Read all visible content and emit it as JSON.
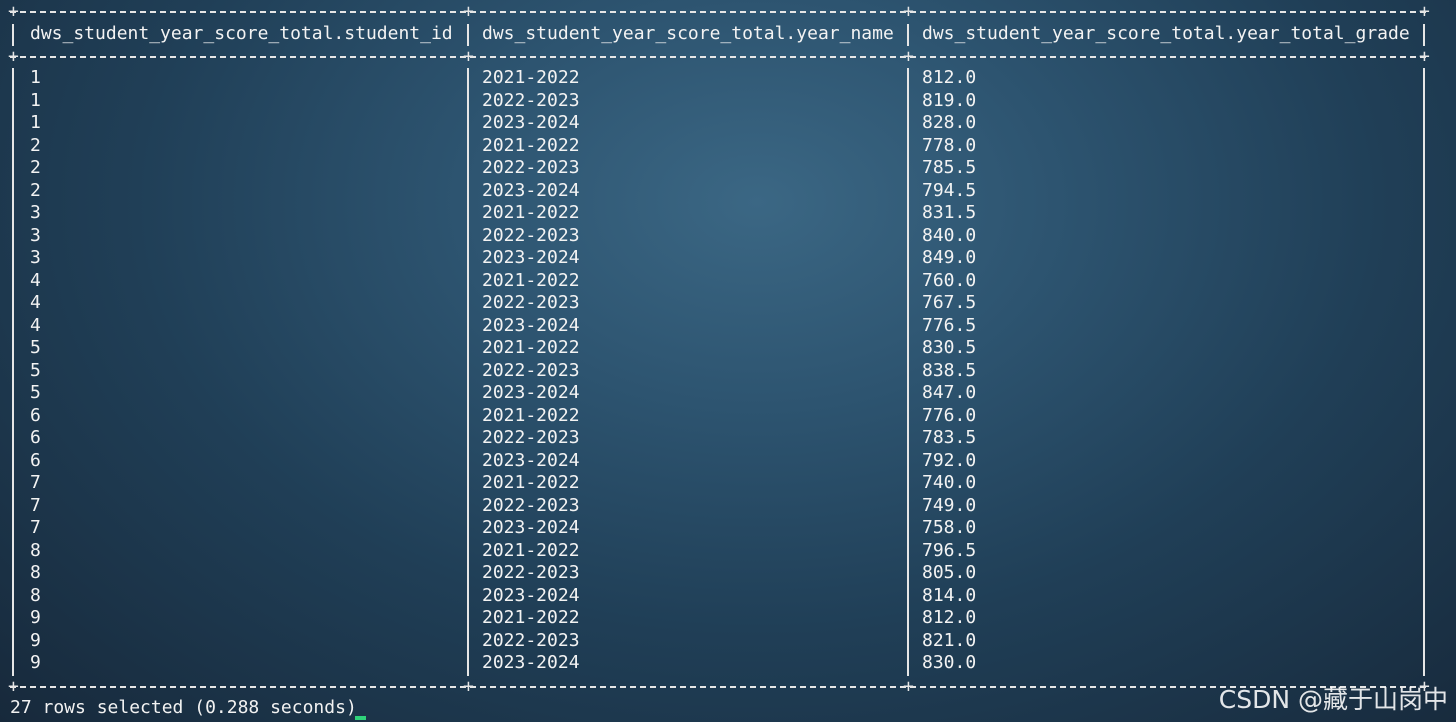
{
  "table": {
    "headers": [
      "dws_student_year_score_total.student_id",
      "dws_student_year_score_total.year_name",
      "dws_student_year_score_total.year_total_grade"
    ],
    "rows": [
      [
        "1",
        "2021-2022",
        "812.0"
      ],
      [
        "1",
        "2022-2023",
        "819.0"
      ],
      [
        "1",
        "2023-2024",
        "828.0"
      ],
      [
        "2",
        "2021-2022",
        "778.0"
      ],
      [
        "2",
        "2022-2023",
        "785.5"
      ],
      [
        "2",
        "2023-2024",
        "794.5"
      ],
      [
        "3",
        "2021-2022",
        "831.5"
      ],
      [
        "3",
        "2022-2023",
        "840.0"
      ],
      [
        "3",
        "2023-2024",
        "849.0"
      ],
      [
        "4",
        "2021-2022",
        "760.0"
      ],
      [
        "4",
        "2022-2023",
        "767.5"
      ],
      [
        "4",
        "2023-2024",
        "776.5"
      ],
      [
        "5",
        "2021-2022",
        "830.5"
      ],
      [
        "5",
        "2022-2023",
        "838.5"
      ],
      [
        "5",
        "2023-2024",
        "847.0"
      ],
      [
        "6",
        "2021-2022",
        "776.0"
      ],
      [
        "6",
        "2022-2023",
        "783.5"
      ],
      [
        "6",
        "2023-2024",
        "792.0"
      ],
      [
        "7",
        "2021-2022",
        "740.0"
      ],
      [
        "7",
        "2022-2023",
        "749.0"
      ],
      [
        "7",
        "2023-2024",
        "758.0"
      ],
      [
        "8",
        "2021-2022",
        "796.5"
      ],
      [
        "8",
        "2022-2023",
        "805.0"
      ],
      [
        "8",
        "2023-2024",
        "814.0"
      ],
      [
        "9",
        "2021-2022",
        "812.0"
      ],
      [
        "9",
        "2022-2023",
        "821.0"
      ],
      [
        "9",
        "2023-2024",
        "830.0"
      ]
    ]
  },
  "status": "27 rows selected (0.288 seconds)",
  "watermark": "CSDN @藏于山岗中",
  "colors": {
    "cursor": "#2fd37a",
    "text": "#f3f3f3"
  }
}
